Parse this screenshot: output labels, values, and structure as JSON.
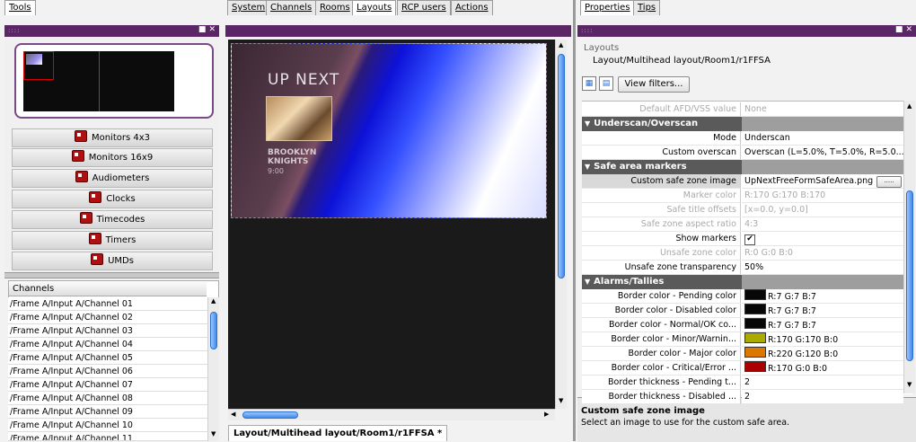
{
  "left_panel": {
    "tab": "Tools",
    "buttons": [
      "Monitors 4x3",
      "Monitors 16x9",
      "Audiometers",
      "Clocks",
      "Timecodes",
      "Timers",
      "UMDs"
    ],
    "channels_header": "Channels",
    "channels": [
      "/Frame A/Input A/Channel 01",
      "/Frame A/Input A/Channel 02",
      "/Frame A/Input A/Channel 03",
      "/Frame A/Input A/Channel 04",
      "/Frame A/Input A/Channel 05",
      "/Frame A/Input A/Channel 06",
      "/Frame A/Input A/Channel 07",
      "/Frame A/Input A/Channel 08",
      "/Frame A/Input A/Channel 09",
      "/Frame A/Input A/Channel 10",
      "/Frame A/Input A/Channel 11"
    ]
  },
  "center_panel": {
    "tabs": [
      "System",
      "Channels",
      "Rooms",
      "Layouts",
      "RCP users",
      "Actions"
    ],
    "active_tab": "Layouts",
    "preview": {
      "heading": "UP NEXT",
      "show_line1": "BROOKLYN",
      "show_line2": "KNIGHTS",
      "time": "9:00"
    },
    "doc_tab": "Layout/Multihead layout/Room1/r1FFSA *"
  },
  "right_panel": {
    "tabs": [
      "Properties",
      "Tips"
    ],
    "active_tab": "Properties",
    "title": "Layouts",
    "path": "Layout/Multihead layout/Room1/r1FFSA",
    "view_filters_label": "View filters...",
    "rows": [
      {
        "type": "row",
        "name": "Default AFD/VSS value",
        "value": "None",
        "disabled": true
      },
      {
        "type": "section",
        "name": "Underscan/Overscan"
      },
      {
        "type": "row",
        "name": "Mode",
        "value": "Underscan"
      },
      {
        "type": "row",
        "name": "Custom overscan",
        "value": "Overscan (L=5.0%, T=5.0%, R=5.0..."
      },
      {
        "type": "section",
        "name": "Safe area markers"
      },
      {
        "type": "row",
        "name": "Custom safe zone image",
        "value": "UpNextFreeFormSafeArea.png",
        "selected": true,
        "browse": true
      },
      {
        "type": "row",
        "name": "Marker color",
        "value": "R:170 G:170 B:170",
        "disabled": true
      },
      {
        "type": "row",
        "name": "Safe title offsets",
        "value": "[x=0.0, y=0.0]",
        "disabled": true
      },
      {
        "type": "row",
        "name": "Safe zone aspect ratio",
        "value": "4:3",
        "disabled": true
      },
      {
        "type": "row",
        "name": "Show markers",
        "value": "",
        "checkbox": true
      },
      {
        "type": "row",
        "name": "Unsafe zone color",
        "value": "R:0 G:0 B:0",
        "disabled": true
      },
      {
        "type": "row",
        "name": "Unsafe zone transparency",
        "value": "50%"
      },
      {
        "type": "section",
        "name": "Alarms/Tallies"
      },
      {
        "type": "row",
        "name": "Border color - Pending color",
        "value": "R:7 G:7 B:7",
        "swatch": "#070707"
      },
      {
        "type": "row",
        "name": "Border color - Disabled color",
        "value": "R:7 G:7 B:7",
        "swatch": "#070707"
      },
      {
        "type": "row",
        "name": "Border color - Normal/OK co...",
        "value": "R:7 G:7 B:7",
        "swatch": "#070707"
      },
      {
        "type": "row",
        "name": "Border color - Minor/Warnin...",
        "value": "R:170 G:170 B:0",
        "swatch": "#aaaa00"
      },
      {
        "type": "row",
        "name": "Border color - Major color",
        "value": "R:220 G:120 B:0",
        "swatch": "#dc7800"
      },
      {
        "type": "row",
        "name": "Border color - Critical/Error ...",
        "value": "R:170 G:0 B:0",
        "swatch": "#aa0000"
      },
      {
        "type": "row",
        "name": "Border thickness - Pending t...",
        "value": "2"
      },
      {
        "type": "row",
        "name": "Border thickness - Disabled ...",
        "value": "2"
      }
    ],
    "tip_title": "Custom safe zone image",
    "tip_text": "Select an image to use for the custom safe area."
  },
  "colors": {
    "titlebar": "#5b2666",
    "accent_border": "#7a4a86",
    "scroll_thumb": "#3f8bea"
  }
}
